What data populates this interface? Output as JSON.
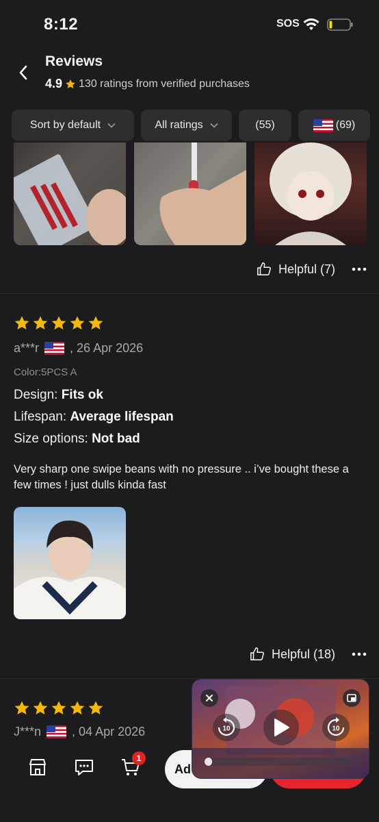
{
  "status": {
    "time": "8:12",
    "sos": "SOS"
  },
  "header": {
    "title": "Reviews",
    "rating_value": "4.9",
    "rating_summary": "130 ratings from verified purchases"
  },
  "filters": {
    "sort": "Sort by default",
    "ratings": "All ratings",
    "photos": "(55)",
    "country": "(69)"
  },
  "first_review_footer": {
    "helpful": "Helpful (7)"
  },
  "review": {
    "stars": 5,
    "author": "a***r",
    "date": ", 26 Apr 2026",
    "color": "Color:5PCS A",
    "attributes": [
      {
        "label": "Design: ",
        "value": "Fits ok"
      },
      {
        "label": "Lifespan: ",
        "value": "Average lifespan"
      },
      {
        "label": "Size options: ",
        "value": "Not bad"
      }
    ],
    "text": "Very sharp one swipe beans with no pressure .. i’ve bought these a few times ! just dulls kinda fast",
    "helpful": "Helpful (18)"
  },
  "next_review": {
    "stars": 5,
    "author": "J***n",
    "date": ", 04 Apr 2026"
  },
  "bottom_bar": {
    "cart_count": "1",
    "add_label": "Ad"
  },
  "pip": {
    "skip_back": "10",
    "skip_forward": "10",
    "progress": 0.05
  },
  "colors": {
    "star": "#f5b70a",
    "accent_red": "#e8242e",
    "background": "#1c1c1e"
  }
}
